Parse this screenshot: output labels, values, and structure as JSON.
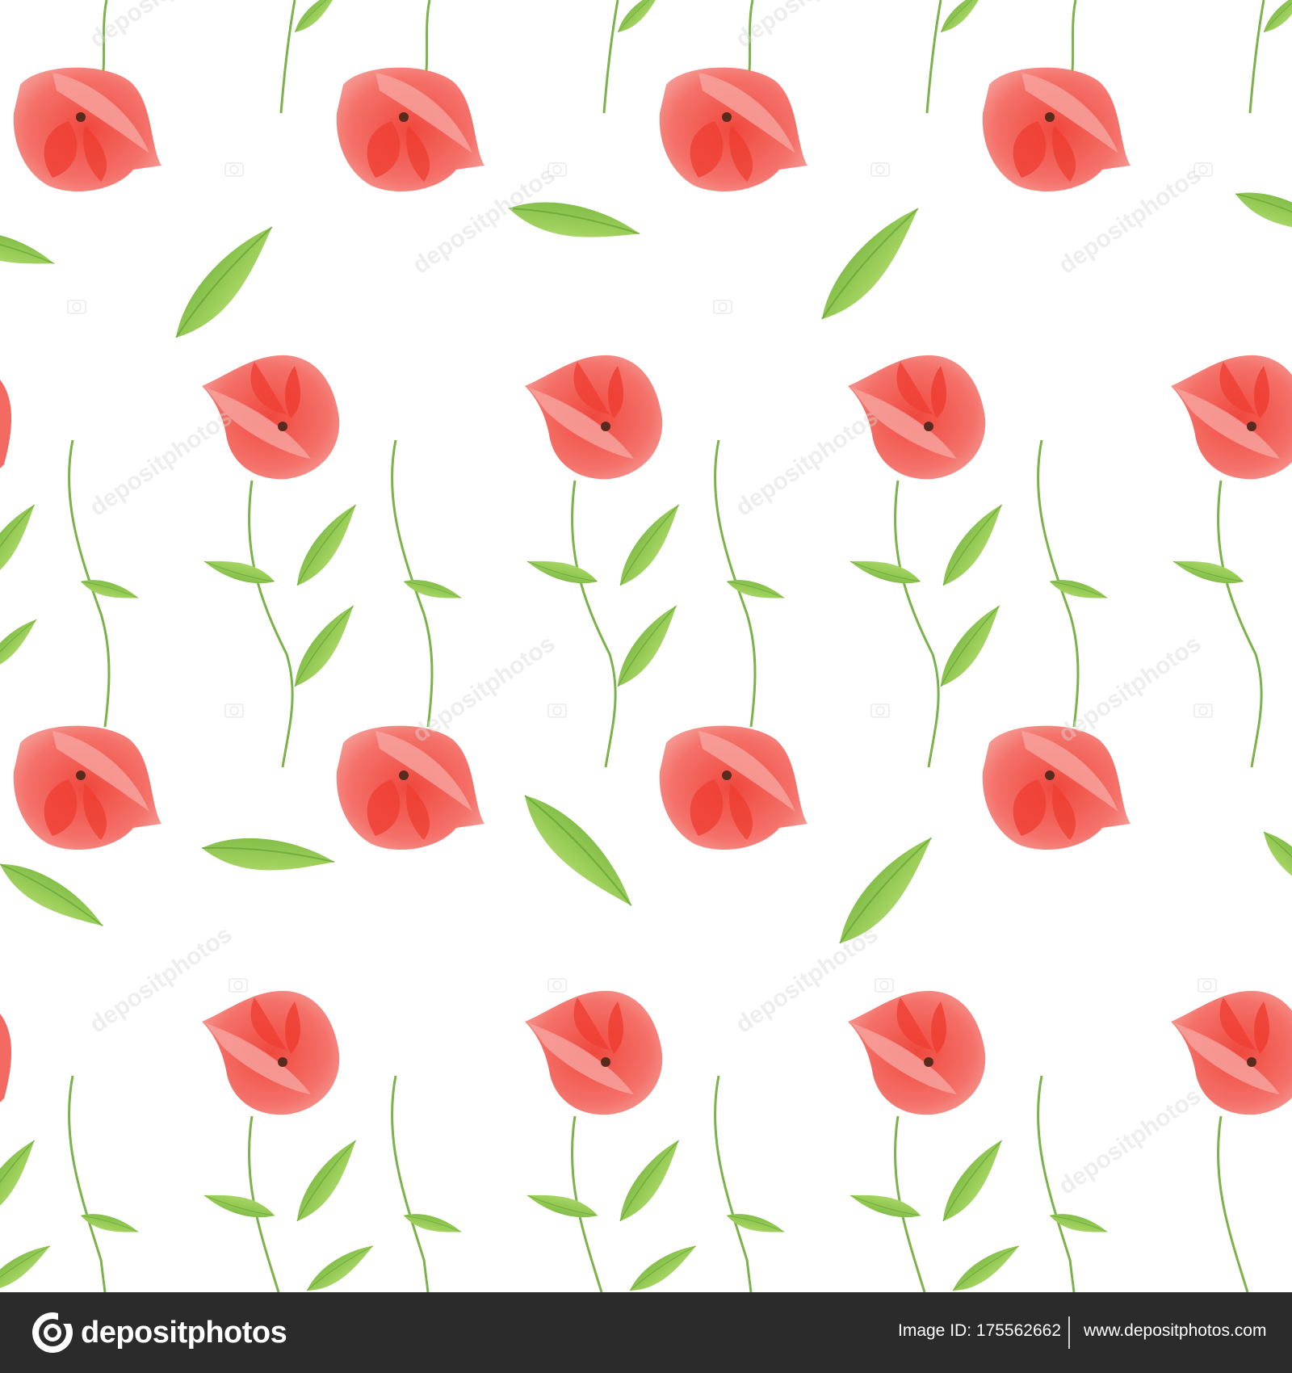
{
  "scene": {
    "description_colors": {
      "background": "#ffffff",
      "petal_light": "#f07470",
      "petal_dark": "#ef3f33",
      "petal_highlight": "#f7a19c",
      "center": "#5a2a1e",
      "leaf_light": "#b9e07a",
      "leaf_dark": "#6cae3a",
      "stem": "#7cb24a"
    },
    "motifs": [
      "poppy-flower",
      "leaf",
      "stem"
    ]
  },
  "watermark": {
    "text": "depositphotos",
    "icon": "camera-icon"
  },
  "footer": {
    "logo_icon": "depositphotos-logo-icon",
    "logo_text": "depositphotos",
    "image_id_label": "Image ID:",
    "image_id_value": "175562662",
    "site_url": "www.depositphotos.com",
    "background_color": "#2b2b2b"
  }
}
